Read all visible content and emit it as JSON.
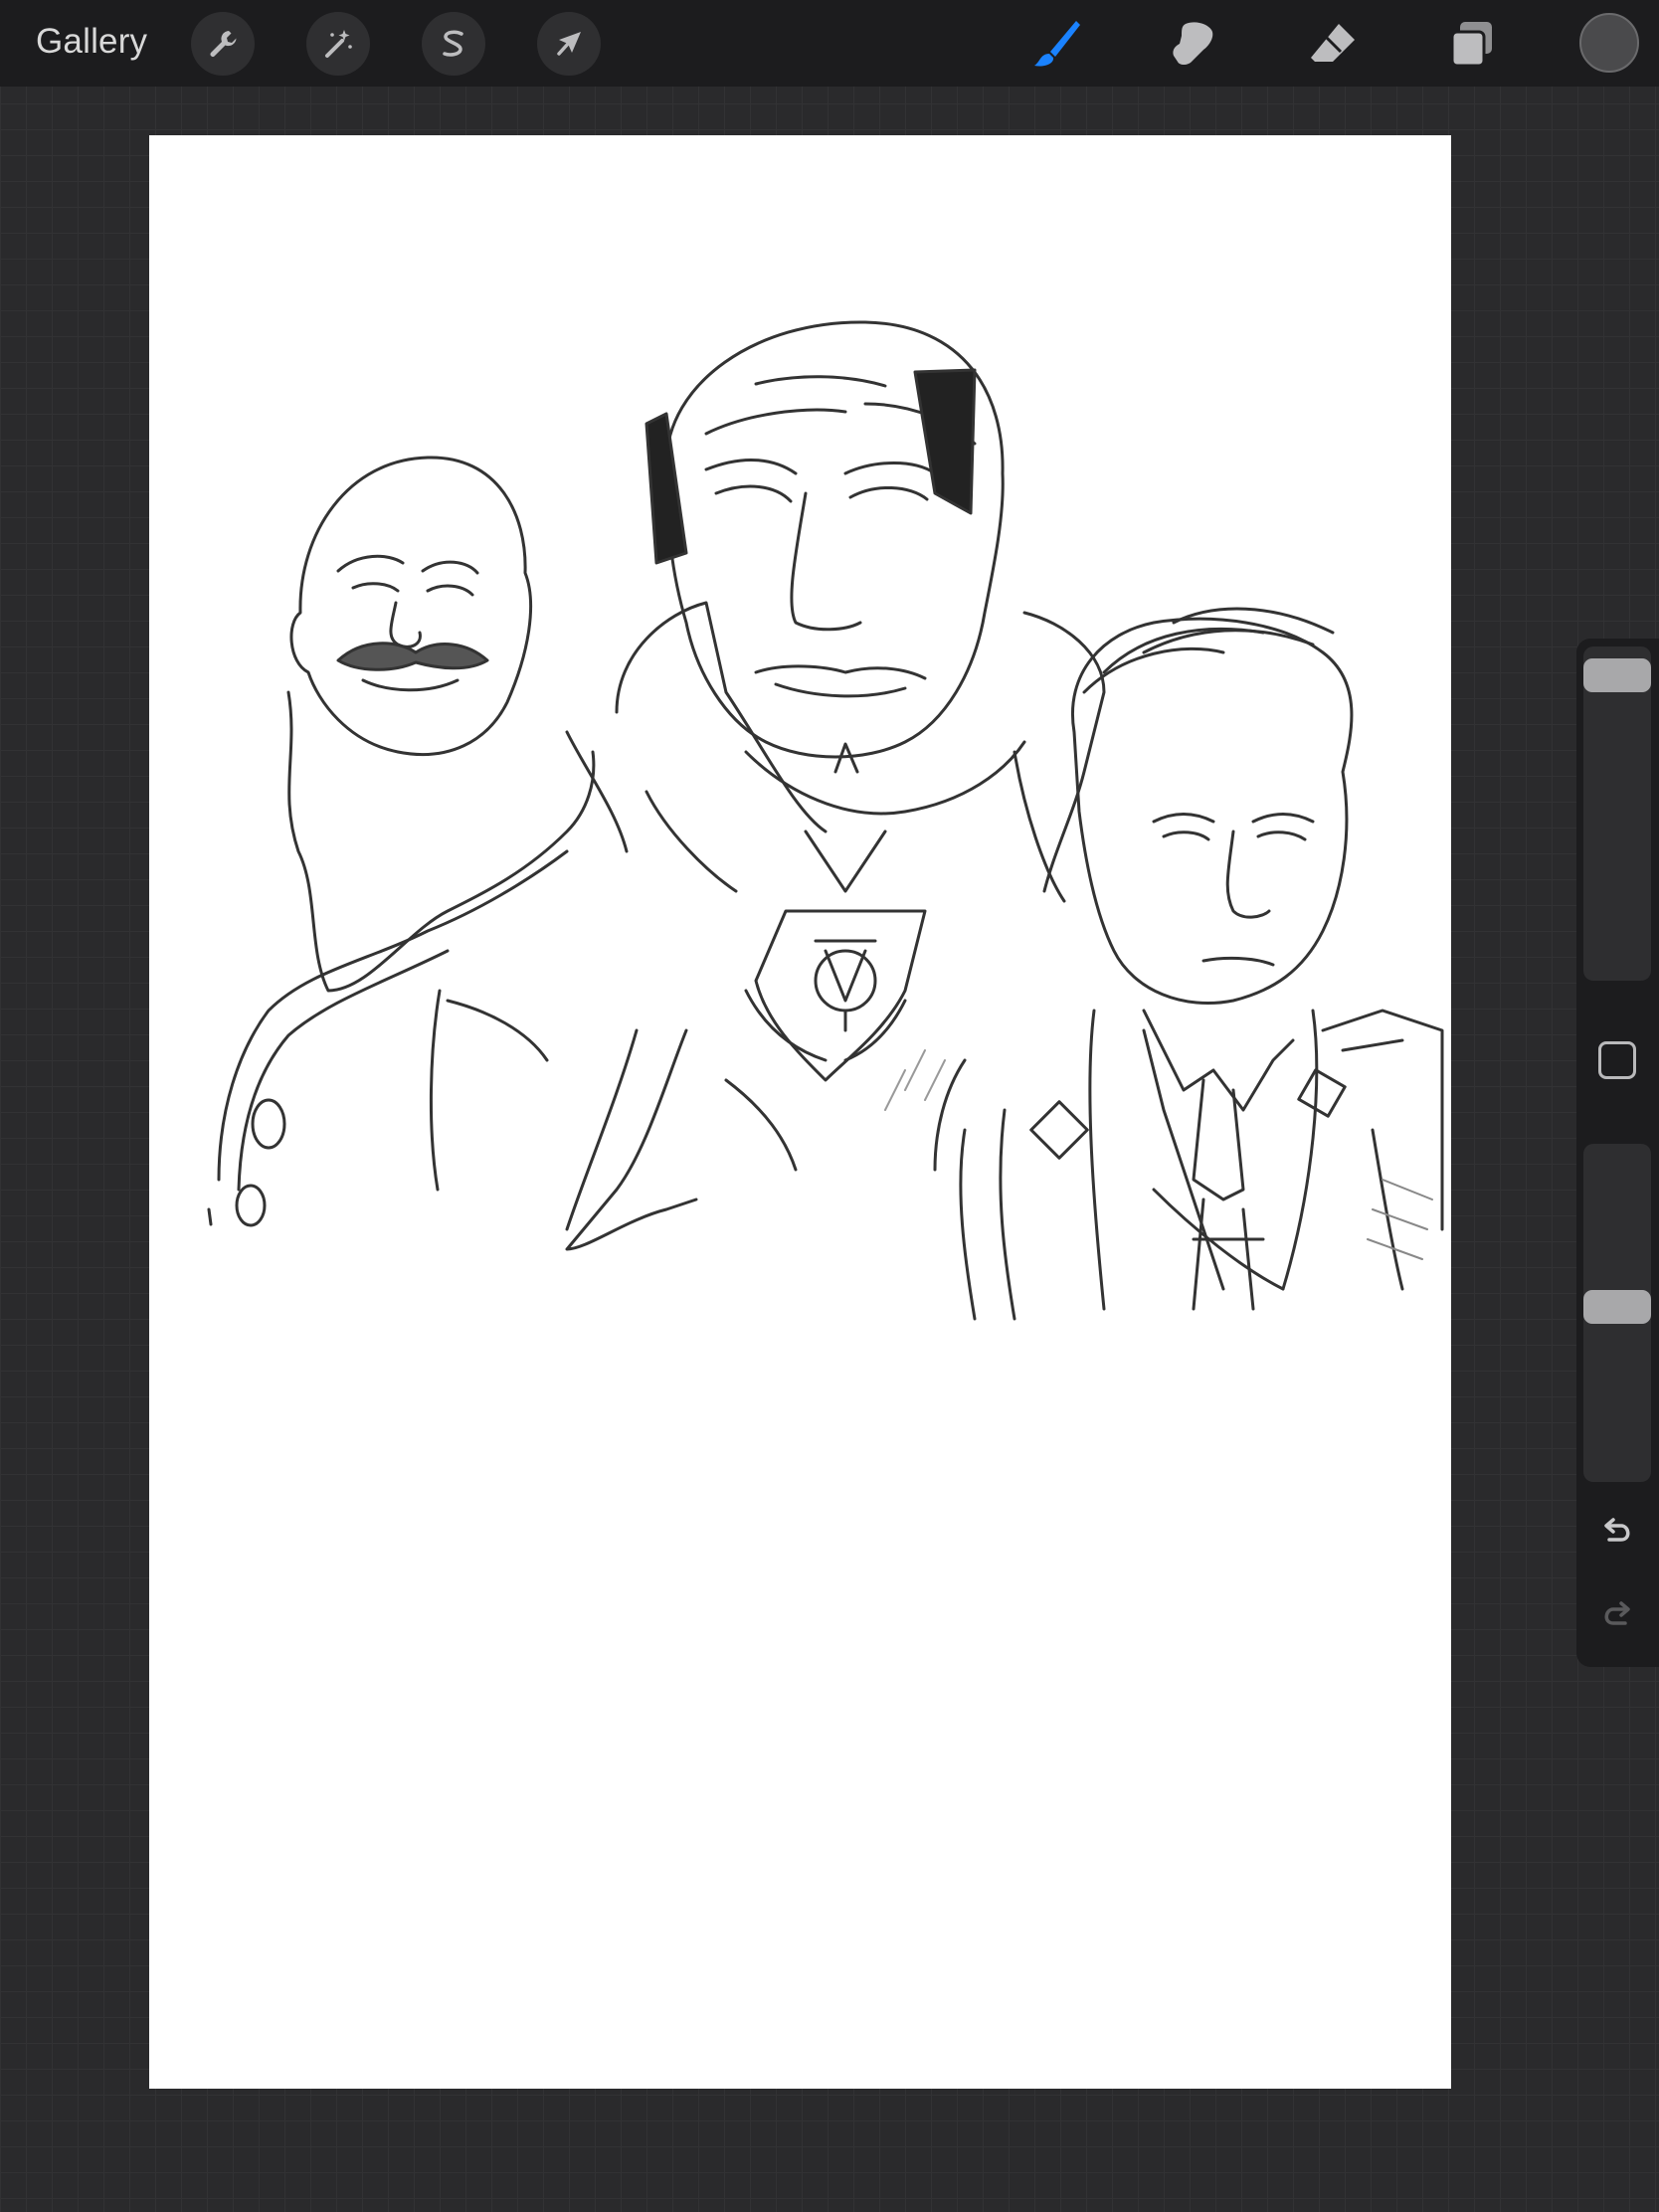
{
  "header": {
    "gallery_label": "Gallery"
  },
  "icons": {
    "actions": "wrench-icon",
    "adjustments": "magic-wand-icon",
    "selection": "selection-s-icon",
    "transform": "arrow-cursor-icon",
    "brush": "brush-icon",
    "smudge": "smudge-finger-icon",
    "eraser": "eraser-icon",
    "layers": "layers-icon",
    "undo": "undo-arrow-icon",
    "redo": "redo-arrow-icon"
  },
  "sidebar": {
    "brush_size": 0.96,
    "brush_opacity": 0.52
  },
  "colors": {
    "active_tool": "#1a82ff",
    "current_color": "#4a4a4c",
    "toolbar_bg": "#1c1c1e",
    "workspace_bg": "#2a2a2c"
  }
}
